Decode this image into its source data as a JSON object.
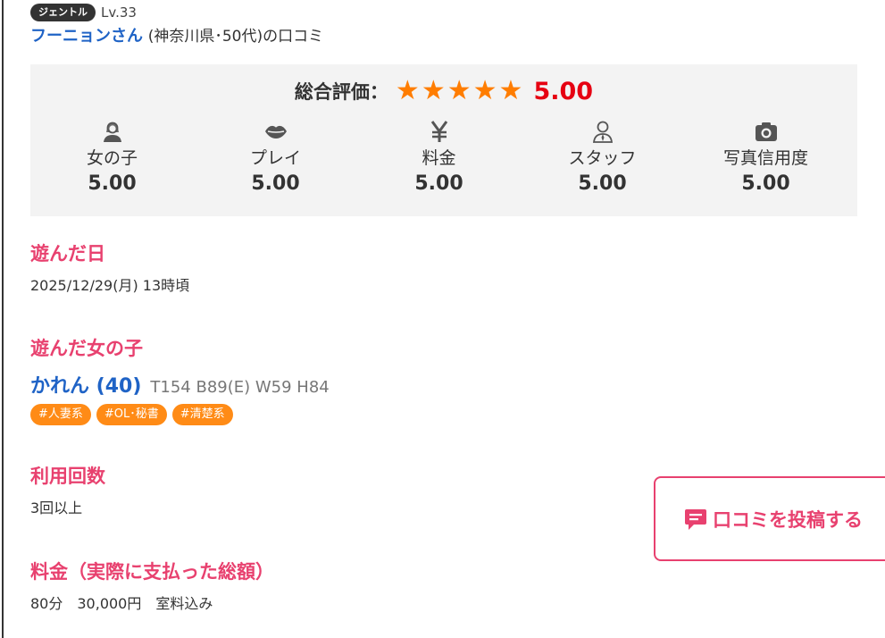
{
  "reviewer": {
    "rank_badge": "ジェントル",
    "level": "Lv.33",
    "name": "フーニョンさん",
    "info": "(神奈川県･50代)の口コミ"
  },
  "overall": {
    "label": "総合評価：",
    "stars": 5,
    "score": "5.00",
    "star_color": "#ff7d00",
    "score_color": "#e60012"
  },
  "categories": [
    {
      "icon": "woman-icon",
      "label": "女の子",
      "score": "5.00"
    },
    {
      "icon": "lips-icon",
      "label": "プレイ",
      "score": "5.00"
    },
    {
      "icon": "yen-icon",
      "label": "料金",
      "score": "5.00"
    },
    {
      "icon": "staff-icon",
      "label": "スタッフ",
      "score": "5.00"
    },
    {
      "icon": "camera-icon",
      "label": "写真信用度",
      "score": "5.00"
    }
  ],
  "visit_date": {
    "title": "遊んだ日",
    "value": "2025/12/29(月) 13時頃"
  },
  "girl": {
    "title": "遊んだ女の子",
    "name": "かれん (40)",
    "stats": "T154 B89(E) W59 H84",
    "tags": [
      "#人妻系",
      "#OL･秘書",
      "#清楚系"
    ]
  },
  "usage": {
    "title": "利用回数",
    "value": "3回以上"
  },
  "fee": {
    "title": "料金（実際に支払った総額）",
    "duration": "80分",
    "amount": "30,000円",
    "note": "室料込み"
  },
  "post_button": {
    "label": "口コミを投稿する",
    "icon": "comment-icon"
  },
  "colors": {
    "accent_pink": "#e8416f",
    "link_blue": "#1f63c6",
    "tag_orange": "#ff8b16",
    "rating_bg": "#f3f3f3"
  }
}
